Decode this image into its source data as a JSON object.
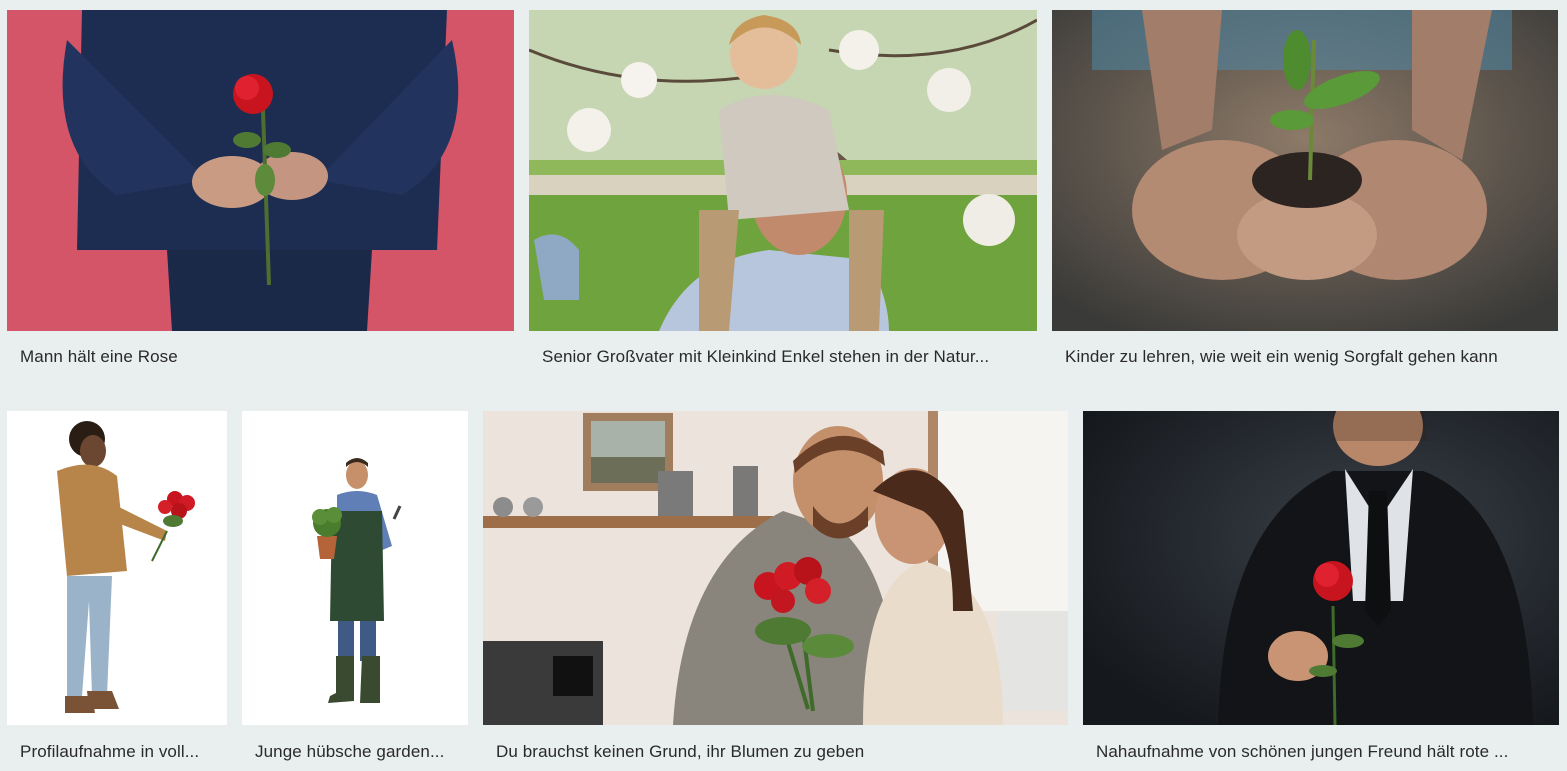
{
  "gallery": {
    "items": [
      {
        "caption": "Mann hält eine Rose",
        "image": "man-holding-rose-behind-back"
      },
      {
        "caption": "Senior Großvater mit Kleinkind Enkel stehen in der Natur...",
        "image": "grandfather-with-toddler-on-shoulders"
      },
      {
        "caption": "Kinder zu lehren, wie weit ein wenig Sorgfalt gehen kann",
        "image": "hands-holding-seedling"
      },
      {
        "caption": "Profilaufnahme in voll...",
        "image": "young-man-holding-roses"
      },
      {
        "caption": "Junge hübsche garden...",
        "image": "gardener-with-potted-plant"
      },
      {
        "caption": "Du brauchst keinen Grund, ihr Blumen zu geben",
        "image": "couple-hugging-with-roses"
      },
      {
        "caption": "Nahaufnahme von schönen jungen Freund hält rote ...",
        "image": "man-in-suit-holding-rose"
      }
    ]
  },
  "colors": {
    "background": "#e9eeee",
    "caption_text": "#2a2a2a",
    "rose_red": "#c8141e"
  }
}
